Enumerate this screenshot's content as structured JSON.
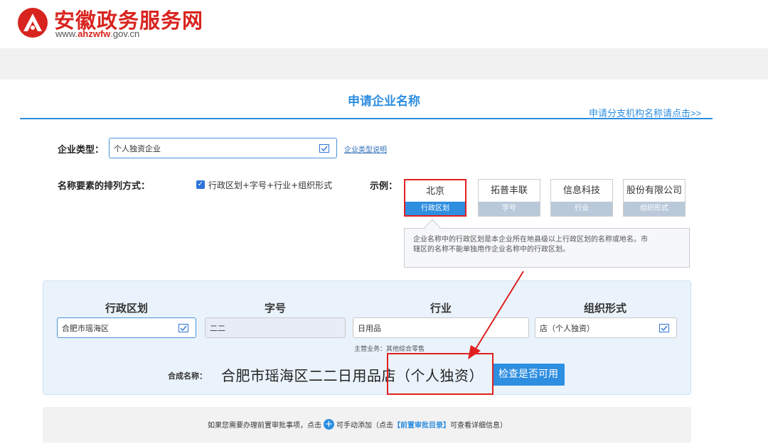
{
  "header": {
    "site_name": "安徽政务服务网",
    "site_url_pre": "www.",
    "site_url_main": "ahzwfw",
    "site_url_post": ".gov.cn"
  },
  "page": {
    "title": "申请企业名称",
    "branch_link": "申请分支机构名称请点击>>"
  },
  "enterprise_type": {
    "label": "企业类型：",
    "value": "个人独资企业",
    "help_link": "企业类型说明"
  },
  "arrangement": {
    "label": "名称要素的排列方式：",
    "option": "行政区划+字号+行业+组织形式",
    "example_label": "示例：",
    "tiles": [
      {
        "name": "北京",
        "type": "行政区划"
      },
      {
        "name": "拓普丰联",
        "type": "字号"
      },
      {
        "name": "信息科技",
        "type": "行业"
      },
      {
        "name": "股份有限公司",
        "type": "组织形式"
      }
    ],
    "tip_line1": "企业名称中的行政区划是本企业所在地县级以上行政区划的名称或地名。市",
    "tip_line2": "辖区的名称不能单独用作企业名称中的行政区划。"
  },
  "compose": {
    "headers": [
      "行政区划",
      "字号",
      "行业",
      "组织形式"
    ],
    "region_value": "合肥市瑶海区",
    "brand_value": "二二",
    "industry_value": "日用品",
    "org_value": "店（个人独资）",
    "industry_hint": "主营业务：其他综合零售",
    "composed_label": "合成名称：",
    "composed_name": "合肥市瑶海区二二日用品店（个人独资）",
    "check_button": "检查是否可用"
  },
  "footer": {
    "text_before": "如果您需要办理前置审批事项，点击",
    "text_middle": "可手动添加（点击",
    "link": "【前置审批目录】",
    "text_after": "可查看详细信息）"
  },
  "colors": {
    "brand_red": "#d8241f",
    "accent_blue": "#2e8ee0",
    "highlight_red": "#e02020"
  }
}
